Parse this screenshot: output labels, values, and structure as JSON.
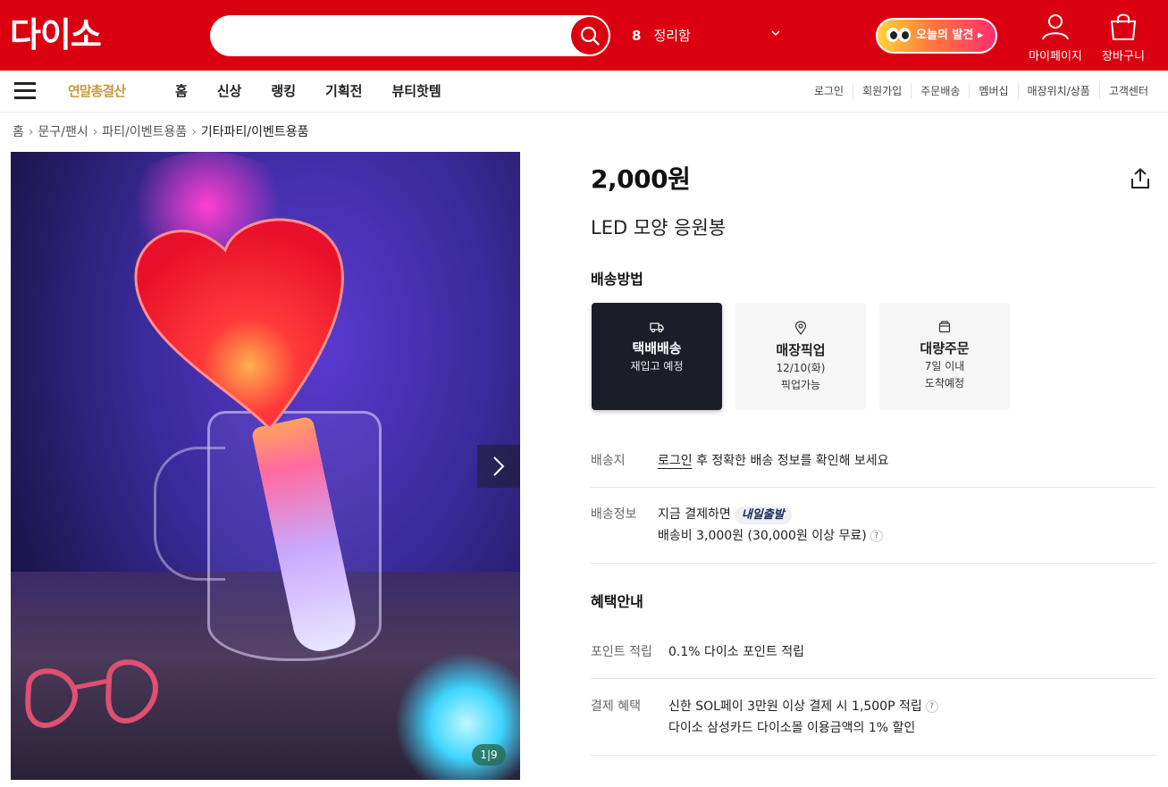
{
  "header": {
    "logo": "다이소",
    "search": {
      "placeholder": ""
    },
    "ranking": {
      "number": "8",
      "keyword": "정리함"
    },
    "discover_label": "오늘의 발견",
    "mypage_label": "마이페이지",
    "cart_label": "장바구니"
  },
  "nav": {
    "promo": "연말총결산",
    "items": [
      "홈",
      "신상",
      "랭킹",
      "기획전",
      "뷰티핫템"
    ],
    "util": [
      "로그인",
      "회원가입",
      "주문배송",
      "멤버십",
      "매장위치/상품",
      "고객센터"
    ]
  },
  "breadcrumb": [
    "홈",
    "문구/팬시",
    "파티/이벤트용품",
    "기타파티/이벤트용품"
  ],
  "gallery": {
    "current": "1",
    "total": "9"
  },
  "product": {
    "price": "2,000원",
    "title": "LED 모양 응원봉"
  },
  "shipping": {
    "title": "배송방법",
    "options": [
      {
        "icon": "truck-icon",
        "title": "택배배송",
        "line1": "재입고 예정",
        "line2": ""
      },
      {
        "icon": "location-pin-icon",
        "title": "매장픽업",
        "line1": "12/10(화)",
        "line2": "픽업가능"
      },
      {
        "icon": "box-icon",
        "title": "대량주문",
        "line1": "7일 이내",
        "line2": "도착예정"
      }
    ],
    "destination": {
      "label": "배송지",
      "login_link": "로그인",
      "text": " 후 정확한 배송 정보를 확인해 보세요"
    },
    "info": {
      "label": "배송정보",
      "line1": "지금 결제하면",
      "badge": "내일출발",
      "line2": "배송비 3,000원 (30,000원 이상 무료)"
    }
  },
  "benefits": {
    "title": "혜택안내",
    "point": {
      "label": "포인트 적립",
      "value": "0.1% 다이소 포인트 적립"
    },
    "payment": {
      "label": "결제 혜택",
      "line1": "신한 SOL페이 3만원 이상 결제 시 1,500P 적립",
      "line2": "다이소 삼성카드 다이소몰 이용금액의 1% 할인"
    }
  },
  "colors": {
    "brand_red": "#da0012",
    "active_card": "#1b1e27"
  }
}
